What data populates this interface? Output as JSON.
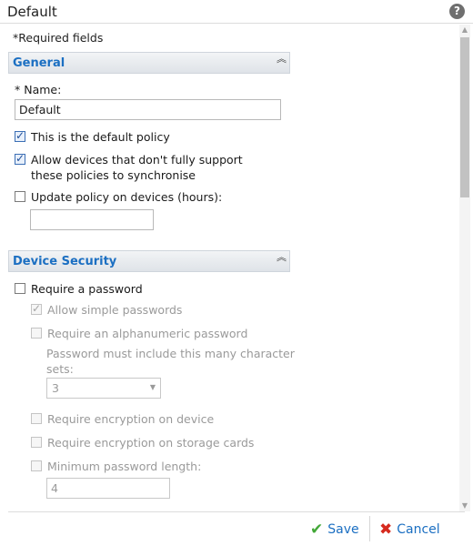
{
  "window": {
    "title": "Default",
    "help_icon_glyph": "?"
  },
  "required_note": "*Required fields",
  "general": {
    "header": "General",
    "name_label": "* Name:",
    "name_value": "Default",
    "default_policy": {
      "label": "This is the default policy",
      "checked": true
    },
    "allow_devices": {
      "label_line1": "Allow devices that don't fully support",
      "label_line2": "these policies to synchronise",
      "checked": true
    },
    "update_policy": {
      "label": "Update policy on devices (hours):",
      "checked": false,
      "value": ""
    }
  },
  "device_security": {
    "header": "Device Security",
    "require_password": {
      "label": "Require a password",
      "checked": false
    },
    "allow_simple": {
      "label": "Allow simple passwords",
      "checked": true,
      "disabled": true
    },
    "require_alnum": {
      "label": "Require an alphanumeric password",
      "checked": false,
      "disabled": true
    },
    "char_sets_label_line1": "Password must include this many character",
    "char_sets_label_line2": "sets:",
    "char_sets_value": "3",
    "encryption_device": {
      "label": "Require encryption on device",
      "checked": false,
      "disabled": true
    },
    "encryption_cards": {
      "label": "Require encryption on storage cards",
      "checked": false,
      "disabled": true
    },
    "min_length": {
      "label": "Minimum password length:",
      "checked": false,
      "disabled": true,
      "value": "4"
    }
  },
  "footer": {
    "save_label": "Save",
    "cancel_label": "Cancel"
  },
  "colors": {
    "accent": "#1b6fc2",
    "save_icon": "#43a838",
    "cancel_icon": "#d62a1e"
  },
  "icons": {
    "help": "help-icon",
    "collapse": "collapse-chevrons-icon",
    "save": "checkmark-icon",
    "cancel": "x-icon",
    "dropdown": "chevron-down-icon"
  }
}
